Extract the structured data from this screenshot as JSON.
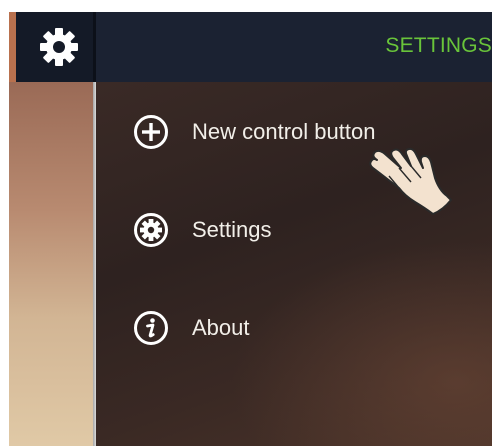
{
  "header": {
    "title": "SETTINGS",
    "menu_icon": "gear-icon",
    "title_color": "#69c43a"
  },
  "menu": {
    "items": [
      {
        "label": "New control button",
        "icon": "plus-circle-icon"
      },
      {
        "label": "Settings",
        "icon": "gear-circle-icon"
      },
      {
        "label": "About",
        "icon": "info-circle-icon"
      }
    ]
  },
  "overlay": {
    "pointer": "hand-pointer-icon"
  }
}
